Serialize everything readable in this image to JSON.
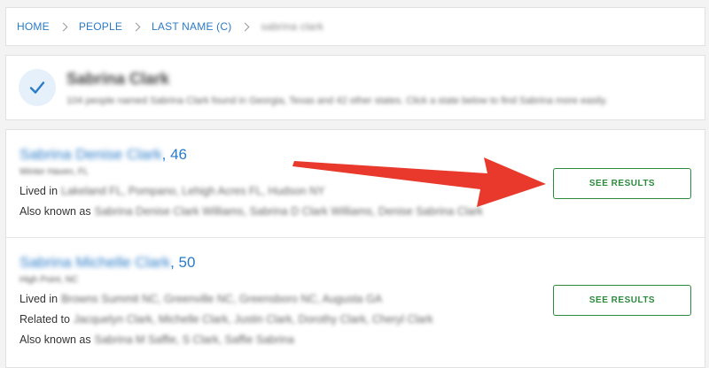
{
  "breadcrumb": {
    "items": [
      "HOME",
      "PEOPLE",
      "LAST NAME (C)",
      "sabrina clark"
    ]
  },
  "header": {
    "title": "Sabrina Clark",
    "subtitle": "104 people named Sabrina Clark found in Georgia, Texas and 42 other states. Click a state below to find Sabrina more easily."
  },
  "results": [
    {
      "name": "Sabrina Denise Clark",
      "age": ", 46",
      "location": "Winter Haven, FL",
      "details": [
        {
          "label": "Lived in",
          "value": "Lakeland FL, Pompano, Lehigh Acres FL, Hudson NY"
        },
        {
          "label": "Also known as",
          "value": "Sabrina Denise Clark Williams, Sabrina D Clark Williams, Denise Sabrina Clark"
        }
      ],
      "button": "SEE RESULTS"
    },
    {
      "name": "Sabrina Michelle Clark",
      "age": ", 50",
      "location": "High Point, NC",
      "details": [
        {
          "label": "Lived in",
          "value": "Browns Summit NC, Greenville NC, Greensboro NC, Augusta GA"
        },
        {
          "label": "Related to",
          "value": "Jacquelyn Clark, Michelle Clark, Justin Clark, Dorothy Clark, Cheryl Clark"
        },
        {
          "label": "Also known as",
          "value": "Sabrina M Saffie, S Clark, Saffie Sabrina"
        }
      ],
      "button": "SEE RESULTS"
    }
  ],
  "colors": {
    "link": "#2a7bc8",
    "button_green": "#2c8a3d",
    "arrow_red": "#e8392c",
    "check_bg": "#e6f0fa"
  },
  "icons": {
    "check": "checkmark-icon",
    "separator": "chevron-right-icon",
    "annotation": "red-arrow"
  }
}
